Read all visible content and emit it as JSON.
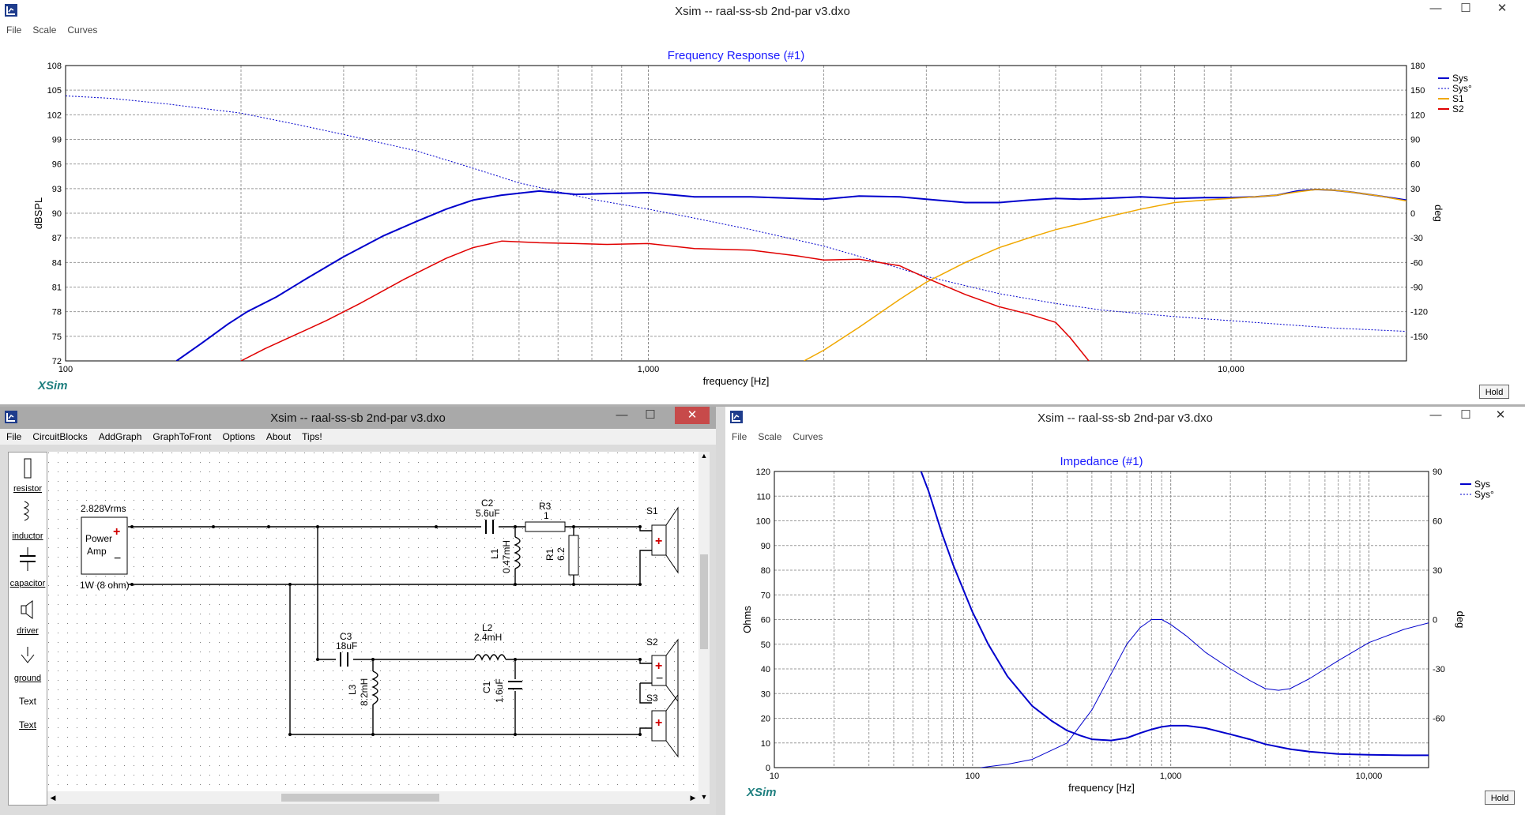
{
  "freq_window": {
    "title": "Xsim -- raal-ss-sb 2nd-par v3.dxo",
    "menu": [
      "File",
      "Scale",
      "Curves"
    ],
    "controls": {
      "minimize": "—",
      "maximize": "☐",
      "close": "✕"
    },
    "hold_label": "Hold",
    "logo": "XSim",
    "chart_data": {
      "type": "line",
      "title": "Frequency Response (#1)",
      "xlabel": "frequency [Hz]",
      "ylabel": "dBSPL",
      "y2label": "deg",
      "xscale": "log",
      "xlim": [
        100,
        20000
      ],
      "ylim": [
        72,
        108
      ],
      "y2lim": [
        -180,
        180
      ],
      "xticks": [
        {
          "v": 100,
          "t": "100"
        },
        {
          "v": 1000,
          "t": "1,000"
        },
        {
          "v": 10000,
          "t": "10,000"
        }
      ],
      "yticks": [
        "72",
        "75",
        "78",
        "81",
        "84",
        "87",
        "90",
        "93",
        "96",
        "99",
        "102",
        "105",
        "108"
      ],
      "y2ticks": [
        "-150",
        "-120",
        "-90",
        "-60",
        "-30",
        "0",
        "30",
        "60",
        "90",
        "120",
        "150",
        "180"
      ],
      "grid": true,
      "legend_position": "right",
      "legend": [
        {
          "name": "Sys",
          "color": "#0000cc",
          "dash": false
        },
        {
          "name": "Sys°",
          "color": "#0000cc",
          "dash": true
        },
        {
          "name": "S1",
          "color": "#f0a800",
          "dash": false
        },
        {
          "name": "S2",
          "color": "#e00000",
          "dash": false
        }
      ],
      "series": [
        {
          "name": "Sys",
          "axis": "left",
          "color": "#0000cc",
          "width": 2,
          "x": [
            155,
            170,
            190,
            205,
            230,
            260,
            300,
            350,
            400,
            450,
            500,
            560,
            650,
            750,
            850,
            1000,
            1200,
            1500,
            1800,
            2000,
            2300,
            2700,
            3000,
            3500,
            4000,
            4500,
            5000,
            5500,
            6000,
            7000,
            8000,
            9000,
            10000,
            11000,
            12000,
            13000,
            14000,
            15000,
            16000,
            18000,
            20000
          ],
          "y": [
            72,
            74,
            76.5,
            78,
            79.8,
            82.1,
            84.7,
            87.2,
            89,
            90.5,
            91.6,
            92.2,
            92.7,
            92.3,
            92.4,
            92.5,
            92,
            92,
            91.8,
            91.7,
            92.1,
            92,
            91.7,
            91.3,
            91.3,
            91.6,
            91.8,
            91.7,
            91.8,
            92,
            91.8,
            91.9,
            91.9,
            92,
            92.2,
            92.7,
            92.9,
            92.8,
            92.6,
            92.1,
            91.6
          ]
        },
        {
          "name": "Sys°",
          "axis": "right",
          "color": "#0000cc",
          "width": 1,
          "dash": true,
          "x": [
            100,
            120,
            150,
            200,
            250,
            300,
            400,
            500,
            600,
            800,
            1000,
            1200,
            1500,
            2000,
            2500,
            3000,
            4000,
            5000,
            6000,
            8000,
            10000,
            12000,
            15000,
            20000
          ],
          "y": [
            143,
            140,
            133,
            122,
            108,
            96,
            76,
            55,
            37,
            17,
            5,
            -6,
            -20,
            -40,
            -60,
            -77,
            -98,
            -110,
            -118,
            -126,
            -131,
            -135,
            -140,
            -144
          ]
        },
        {
          "name": "S1",
          "axis": "left",
          "color": "#f0a800",
          "width": 1.5,
          "x": [
            1850,
            2000,
            2300,
            2700,
            3000,
            3500,
            4000,
            4500,
            5000,
            5500,
            6000,
            7000,
            8000,
            9000,
            10000,
            11000,
            12000,
            13000,
            14000,
            15000,
            16000,
            18000,
            20000
          ],
          "y": [
            72,
            73.3,
            76.1,
            79.5,
            81.6,
            84,
            85.8,
            87,
            88,
            88.7,
            89.4,
            90.5,
            91.3,
            91.6,
            91.8,
            92,
            92.2,
            92.6,
            92.9,
            92.8,
            92.6,
            92.1,
            91.5
          ]
        },
        {
          "name": "S2",
          "axis": "left",
          "color": "#e00000",
          "width": 1.5,
          "x": [
            200,
            220,
            250,
            280,
            320,
            380,
            450,
            500,
            560,
            650,
            750,
            850,
            1000,
            1200,
            1500,
            1800,
            2000,
            2300,
            2700,
            3000,
            3500,
            4000,
            4500,
            5000,
            5300,
            5700
          ],
          "y": [
            72,
            73.5,
            75.3,
            76.9,
            79,
            81.9,
            84.5,
            85.8,
            86.6,
            86.4,
            86.3,
            86.2,
            86.3,
            85.7,
            85.5,
            84.8,
            84.3,
            84.4,
            83.6,
            82.1,
            80.1,
            78.6,
            77.7,
            76.7,
            74.8,
            72
          ]
        }
      ]
    }
  },
  "circuit_window": {
    "title": "Xsim -- raal-ss-sb 2nd-par v3.dxo",
    "menu": [
      "File",
      "CircuitBlocks",
      "AddGraph",
      "GraphToFront",
      "Options",
      "About",
      "Tips!"
    ],
    "controls": {
      "minimize": "—",
      "maximize": "☐",
      "close": "✕"
    },
    "palette": {
      "resistor": "resistor",
      "inductor": "inductor",
      "capacitor": "capacitor",
      "driver": "driver",
      "ground": "ground",
      "text_glyph": "Text",
      "text_link": "Text"
    },
    "labels": {
      "source_voltage": "2.828Vrms",
      "amp_line1": "Power",
      "amp_line2": "Amp",
      "source_power": "1W (8 ohm)",
      "c2_name": "C2",
      "c2_val": "5.6uF",
      "r3_name": "R3",
      "r3_val": "1",
      "l1_name": "L1",
      "l1_val": "0.47mH",
      "r1_name": "R1",
      "r1_val": "6.2",
      "s1": "S1",
      "s2": "S2",
      "s3": "S3",
      "c3_name": "C3",
      "c3_val": "18uF",
      "l2_name": "L2",
      "l2_val": "2.4mH",
      "l3_name": "L3",
      "l3_val": "8.2mH",
      "c1_name": "C1",
      "c1_val": "1.6uF",
      "plus": "+",
      "minus": "−"
    }
  },
  "imp_window": {
    "title": "Xsim -- raal-ss-sb 2nd-par v3.dxo",
    "menu": [
      "File",
      "Scale",
      "Curves"
    ],
    "controls": {
      "minimize": "—",
      "maximize": "☐",
      "close": "✕"
    },
    "hold_label": "Hold",
    "logo": "XSim",
    "chart_data": {
      "type": "line",
      "title": "Impedance (#1)",
      "xlabel": "frequency [Hz]",
      "ylabel": "Ohms",
      "y2label": "deg",
      "xscale": "log",
      "xlim": [
        10,
        20000
      ],
      "ylim": [
        0,
        120
      ],
      "y2lim": [
        -90,
        90
      ],
      "xticks": [
        {
          "v": 10,
          "t": "10"
        },
        {
          "v": 100,
          "t": "100"
        },
        {
          "v": 1000,
          "t": "1,000"
        },
        {
          "v": 10000,
          "t": "10,000"
        }
      ],
      "yticks": [
        "0",
        "10",
        "20",
        "30",
        "40",
        "50",
        "60",
        "70",
        "80",
        "90",
        "100",
        "110",
        "120"
      ],
      "y2ticks": [
        "-60",
        "-30",
        "0",
        "30",
        "60",
        "90"
      ],
      "grid": true,
      "legend_position": "right",
      "legend": [
        {
          "name": "Sys",
          "color": "#0000cc",
          "dash": false
        },
        {
          "name": "Sys°",
          "color": "#0000cc",
          "dash": true
        }
      ],
      "series": [
        {
          "name": "Sys",
          "axis": "left",
          "color": "#0000cc",
          "width": 2,
          "x": [
            55,
            60,
            70,
            80,
            100,
            120,
            150,
            200,
            250,
            300,
            350,
            400,
            500,
            600,
            700,
            800,
            900,
            1000,
            1200,
            1500,
            2000,
            2500,
            3000,
            4000,
            5000,
            7000,
            10000,
            15000,
            20000
          ],
          "y": [
            120,
            112,
            95,
            82,
            63,
            50,
            37,
            25,
            19,
            15,
            13,
            11.5,
            11,
            12,
            14,
            15.5,
            16.5,
            17,
            17,
            16,
            13.5,
            11.5,
            9.5,
            7.5,
            6.5,
            5.5,
            5.2,
            5,
            5
          ]
        },
        {
          "name": "Sys°",
          "axis": "right",
          "color": "#0000cc",
          "width": 1,
          "x": [
            110,
            150,
            200,
            300,
            400,
            500,
            600,
            700,
            800,
            900,
            1000,
            1200,
            1500,
            2000,
            2500,
            3000,
            3500,
            4000,
            5000,
            7000,
            10000,
            15000,
            20000
          ],
          "y": [
            -90,
            -88,
            -85,
            -75,
            -55,
            -33,
            -15,
            -5,
            0,
            0,
            -3,
            -10,
            -20,
            -30,
            -37,
            -42,
            -43,
            -42,
            -36,
            -25,
            -14,
            -6,
            -2
          ]
        }
      ]
    }
  }
}
